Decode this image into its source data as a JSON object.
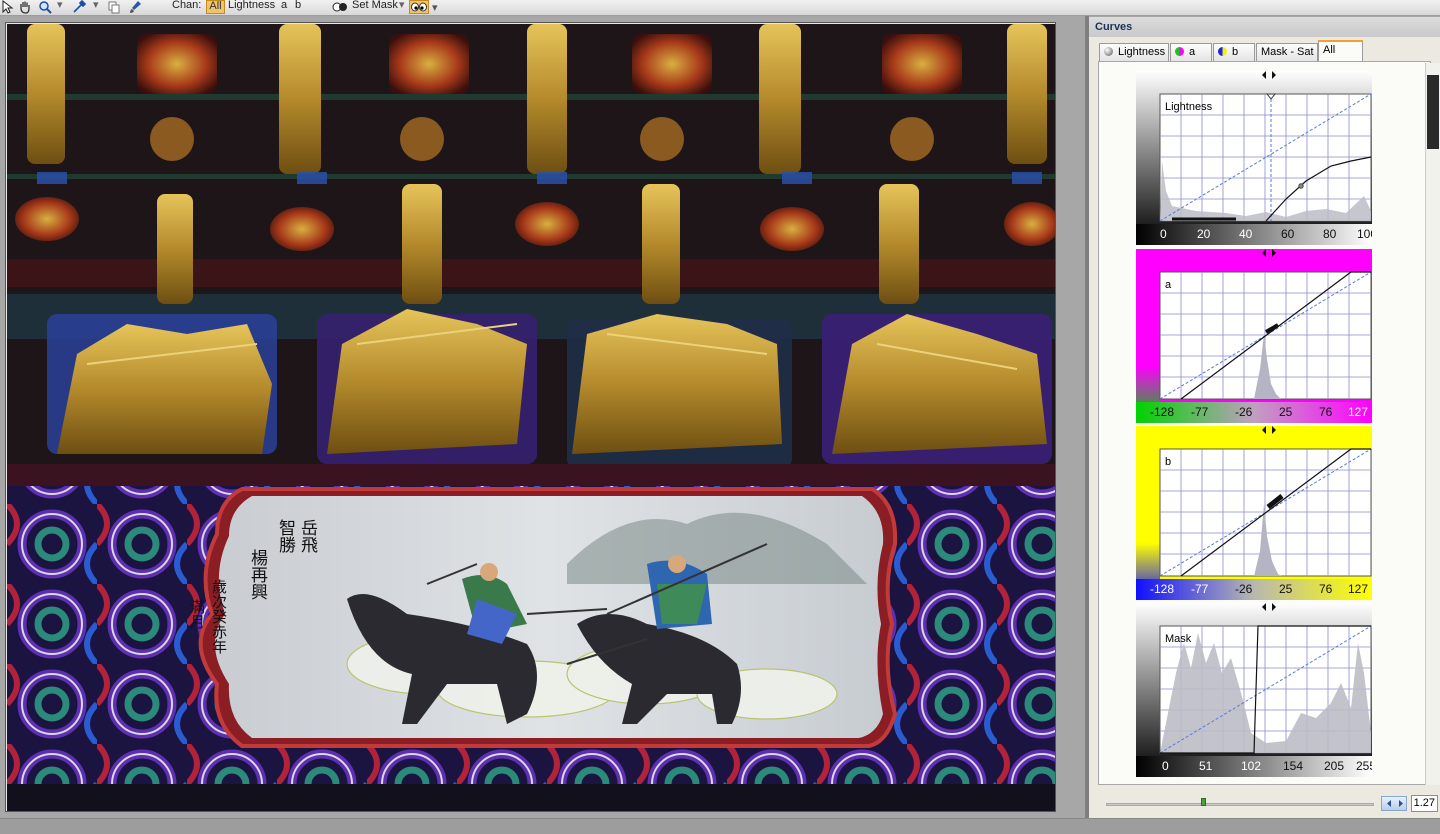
{
  "toolbar": {
    "tools": [
      "arrow-icon",
      "hand-icon",
      "zoom-icon",
      "eyedropper-icon",
      "copy-icon",
      "brush-icon"
    ],
    "chan_label": "Chan:",
    "channels": [
      "All",
      "Lightness",
      "a",
      "b"
    ],
    "active_channel": "All",
    "set_mask_label": "Set Mask"
  },
  "panel": {
    "title": "Curves",
    "tabs": [
      {
        "label": "Lightness",
        "icon": "lightness-dot-icon",
        "color": "#666666"
      },
      {
        "label": "a",
        "icon": "a-dot-icon",
        "color": "#cc33aa"
      },
      {
        "label": "b",
        "icon": "b-dot-icon",
        "color": "#c9b82a"
      },
      {
        "label": "Mask - Sat",
        "icon": "",
        "color": ""
      },
      {
        "label": "All",
        "icon": "",
        "color": ""
      }
    ],
    "active_tab": "All"
  },
  "curves": [
    {
      "id": "lightness",
      "label": "Lightness",
      "ticks": [
        "0",
        "20",
        "40",
        "60",
        "80",
        "100"
      ],
      "frame_colors": [
        "#ffffff",
        "#000000"
      ]
    },
    {
      "id": "a",
      "label": "a",
      "ticks": [
        "-128",
        "-77",
        "-26",
        "25",
        "76",
        "127"
      ],
      "frame_colors": [
        "#ff00ff",
        "#00c000"
      ]
    },
    {
      "id": "b",
      "label": "b",
      "ticks": [
        "-128",
        "-77",
        "-26",
        "25",
        "76",
        "127"
      ],
      "frame_colors": [
        "#ffff00",
        "#0000ff"
      ]
    },
    {
      "id": "mask",
      "label": "Mask",
      "ticks": [
        "0",
        "51",
        "102",
        "154",
        "205",
        "255"
      ],
      "frame_colors": [
        "#ffffff",
        "#000000"
      ]
    }
  ],
  "zoom": {
    "value": "1.27",
    "slider_fraction": 0.37
  },
  "image": {
    "inscription_columns": [
      "岳飛",
      "智勝",
      "楊再興",
      "歲次癸赤年",
      "滿月"
    ]
  }
}
